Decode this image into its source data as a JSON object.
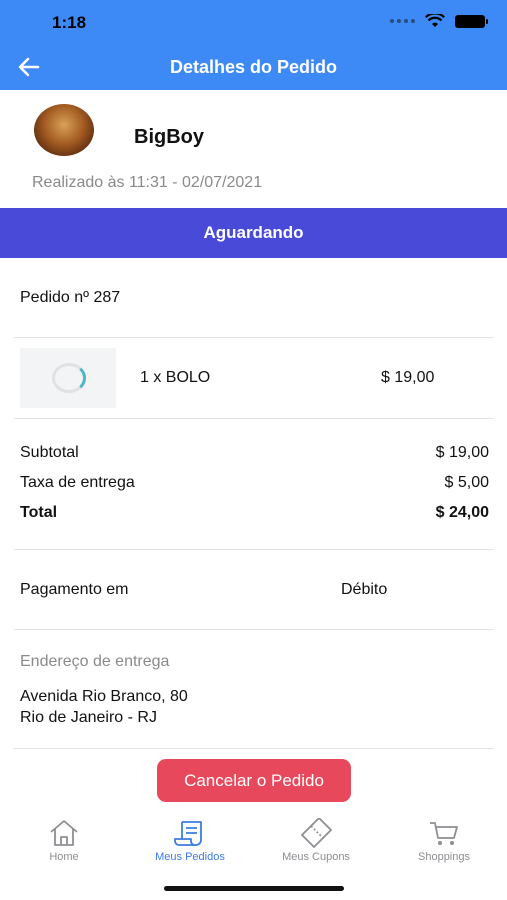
{
  "status_bar": {
    "time": "1:18"
  },
  "header": {
    "title": "Detalhes do Pedido"
  },
  "store": {
    "name": "BigBoy",
    "order_time": "Realizado às 11:31 - 02/07/2021"
  },
  "order_status": "Aguardando",
  "order_number": "Pedido nº 287",
  "items": [
    {
      "description": "1 x BOLO",
      "price": "$ 19,00"
    }
  ],
  "totals": {
    "subtotal_label": "Subtotal",
    "subtotal_value": "$ 19,00",
    "delivery_label": "Taxa de entrega",
    "delivery_value": "$ 5,00",
    "total_label": "Total",
    "total_value": "$ 24,00"
  },
  "payment": {
    "label": "Pagamento em",
    "method": "Débito"
  },
  "address": {
    "label": "Endereço de entrega",
    "line1": "Avenida Rio Branco, 80",
    "line2": "Rio de Janeiro - RJ"
  },
  "cancel_button": "Cancelar o Pedido",
  "tabs": [
    {
      "label": "Home",
      "icon": "home-icon",
      "active": false
    },
    {
      "label": "Meus Pedidos",
      "icon": "orders-icon",
      "active": true
    },
    {
      "label": "Meus Cupons",
      "icon": "coupon-icon",
      "active": false
    },
    {
      "label": "Shoppings",
      "icon": "cart-icon",
      "active": false
    }
  ],
  "colors": {
    "header": "#3d8af7",
    "status_banner": "#4a4ad9",
    "cancel_button": "#e8485c",
    "active_tab": "#3d7be0"
  }
}
